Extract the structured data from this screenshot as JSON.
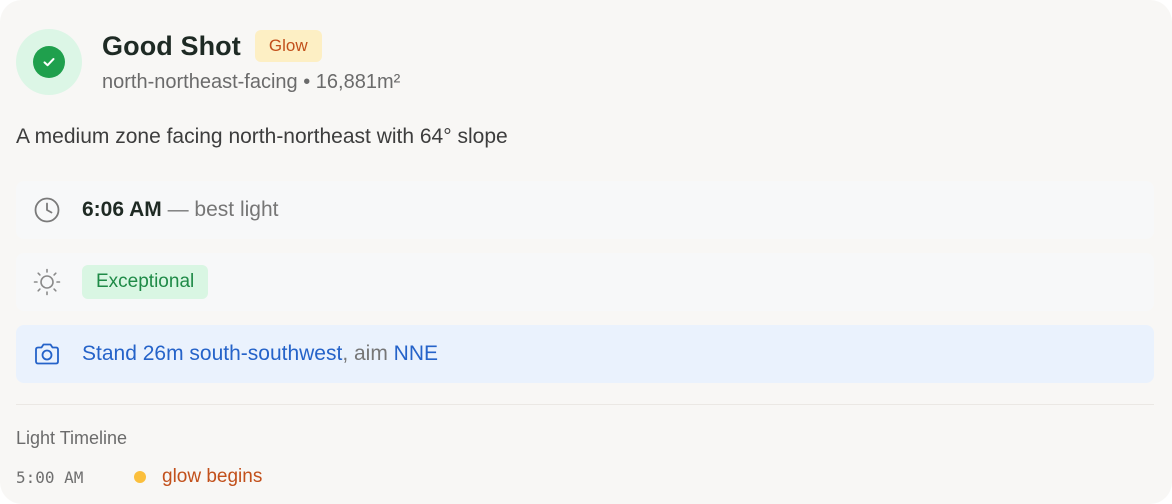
{
  "header": {
    "title": "Good Shot",
    "badge": "Glow",
    "subtitle": "north-northeast-facing • 16,881m²",
    "status_icon": "check-icon"
  },
  "description": "A medium zone facing north-northeast with 64° slope",
  "best_light": {
    "icon": "clock-icon",
    "time": "6:06 AM",
    "suffix": " — best light"
  },
  "quality": {
    "icon": "sun-icon",
    "label": "Exceptional"
  },
  "position": {
    "icon": "camera-icon",
    "stand": "Stand 26m south-southwest",
    "aim_text": ", aim ",
    "aim_direction": "NNE"
  },
  "timeline": {
    "title": "Light Timeline",
    "events": [
      {
        "time": "5:00 AM",
        "label": "glow begins",
        "dot_color": "#fbbf3c"
      }
    ]
  },
  "colors": {
    "success": "#1fa04d",
    "glow_text": "#c2501b",
    "glow_bg": "#fdefc4",
    "link_blue": "#2563c9",
    "exceptional_bg": "#d9f6e3"
  }
}
